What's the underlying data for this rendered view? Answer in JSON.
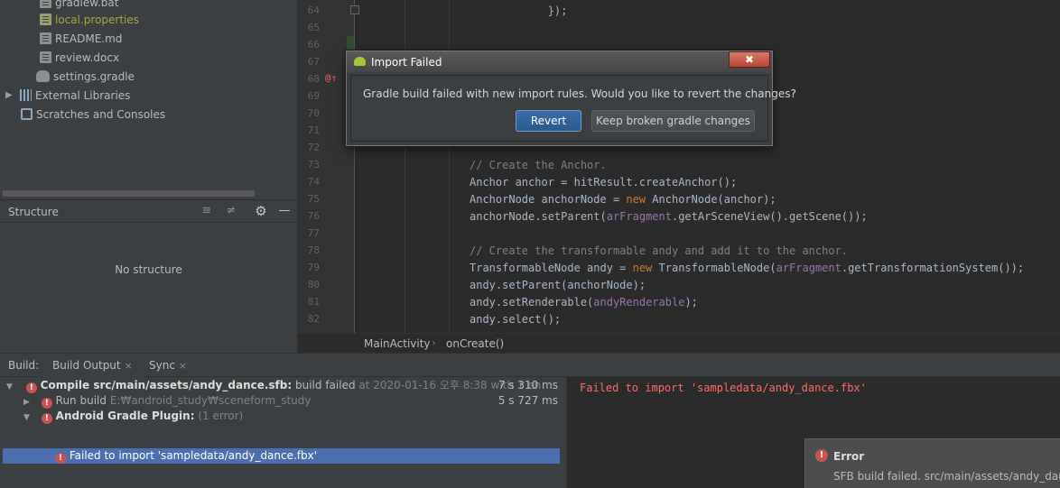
{
  "project_tree": {
    "items": [
      {
        "label": "gradlew.bat",
        "icon": "file-icon"
      },
      {
        "label": "local.properties",
        "icon": "properties-file-icon",
        "color": "#a6a53f"
      },
      {
        "label": "README.md",
        "icon": "file-icon"
      },
      {
        "label": "review.docx",
        "icon": "file-icon"
      },
      {
        "label": "settings.gradle",
        "icon": "gradle-file-icon"
      },
      {
        "label": "External Libraries",
        "icon": "libraries-icon"
      },
      {
        "label": "Scratches and Consoles",
        "icon": "scratches-icon"
      }
    ]
  },
  "structure_panel": {
    "title": "Structure",
    "empty_text": "No structure"
  },
  "editor": {
    "lines": [
      {
        "num": "64",
        "html": "            });"
      },
      {
        "num": "65",
        "html": ""
      },
      {
        "num": "66",
        "html": ""
      },
      {
        "num": "67",
        "html": ""
      },
      {
        "num": "68",
        "html": ""
      },
      {
        "num": "69",
        "html": ""
      },
      {
        "num": "70",
        "html": ""
      },
      {
        "num": "71",
        "html": ""
      },
      {
        "num": "72",
        "html": ""
      },
      {
        "num": "73",
        "html": "<span class=\"cm\">// Create the Anchor.</span>"
      },
      {
        "num": "74",
        "html": "Anchor anchor = hitResult.createAnchor();"
      },
      {
        "num": "75",
        "html": "AnchorNode anchorNode = <span class=\"kw\">new</span> AnchorNode(anchor);"
      },
      {
        "num": "76",
        "html": "anchorNode.setParent(<span class=\"fld\">arFragment</span>.getArSceneView().getScene());"
      },
      {
        "num": "77",
        "html": ""
      },
      {
        "num": "78",
        "html": "<span class=\"cm\">// Create the transformable andy and add it to the anchor.</span>"
      },
      {
        "num": "79",
        "html": "TransformableNode andy = <span class=\"kw\">new</span> TransformableNode(<span class=\"fld\">arFragment</span>.getTransformationSystem());"
      },
      {
        "num": "80",
        "html": "andy.setParent(anchorNode);"
      },
      {
        "num": "81",
        "html": "andy.setRenderable(<span class=\"fld\">andyRenderable</span>);"
      },
      {
        "num": "82",
        "html": "andy.select();"
      }
    ],
    "lambda_tail": "-> {",
    "gutter_marker": "@↑"
  },
  "breadcrumb": {
    "class_name": "MainActivity",
    "separator": "›",
    "method_name": "onCreate()"
  },
  "build_window": {
    "label": "Build:",
    "tabs": [
      {
        "label": "Build Output",
        "close": "×"
      },
      {
        "label": "Sync",
        "close": "×"
      }
    ],
    "rows": [
      {
        "arrow": "▼",
        "title": "Compile src/main/assets/andy_dance.sfb:",
        "status": "build failed",
        "detail": "at 2020-01-16 오후 8:38",
        "extra": "with 1 en",
        "time": "7 s 310 ms"
      },
      {
        "arrow": "▶",
        "title": "Run build",
        "detail": "E:₩android_study₩sceneform_study",
        "time": "5 s 727 ms"
      },
      {
        "arrow": "▼",
        "title": "Android Gradle Plugin:",
        "detail": "(1 error)"
      },
      {
        "title": "Failed to import 'sampledata/andy_dance.fbx'"
      }
    ],
    "console_text": "Failed to import 'sampledata/andy_dance.fbx'"
  },
  "notification": {
    "title": "Error",
    "message": "SFB build failed. src/main/assets/andy_dance"
  },
  "dialog": {
    "title": "Import Failed",
    "close_glyph": "✖",
    "message": "Gradle build failed with new import rules.  Would you like to revert the changes?",
    "revert_label": "Revert",
    "keep_label": "Keep broken gradle changes"
  },
  "colors": {
    "error": "#c75450",
    "selection": "#4b6eaf",
    "console_error": "#ff6b68",
    "primary_button": "#2b5a8c"
  }
}
